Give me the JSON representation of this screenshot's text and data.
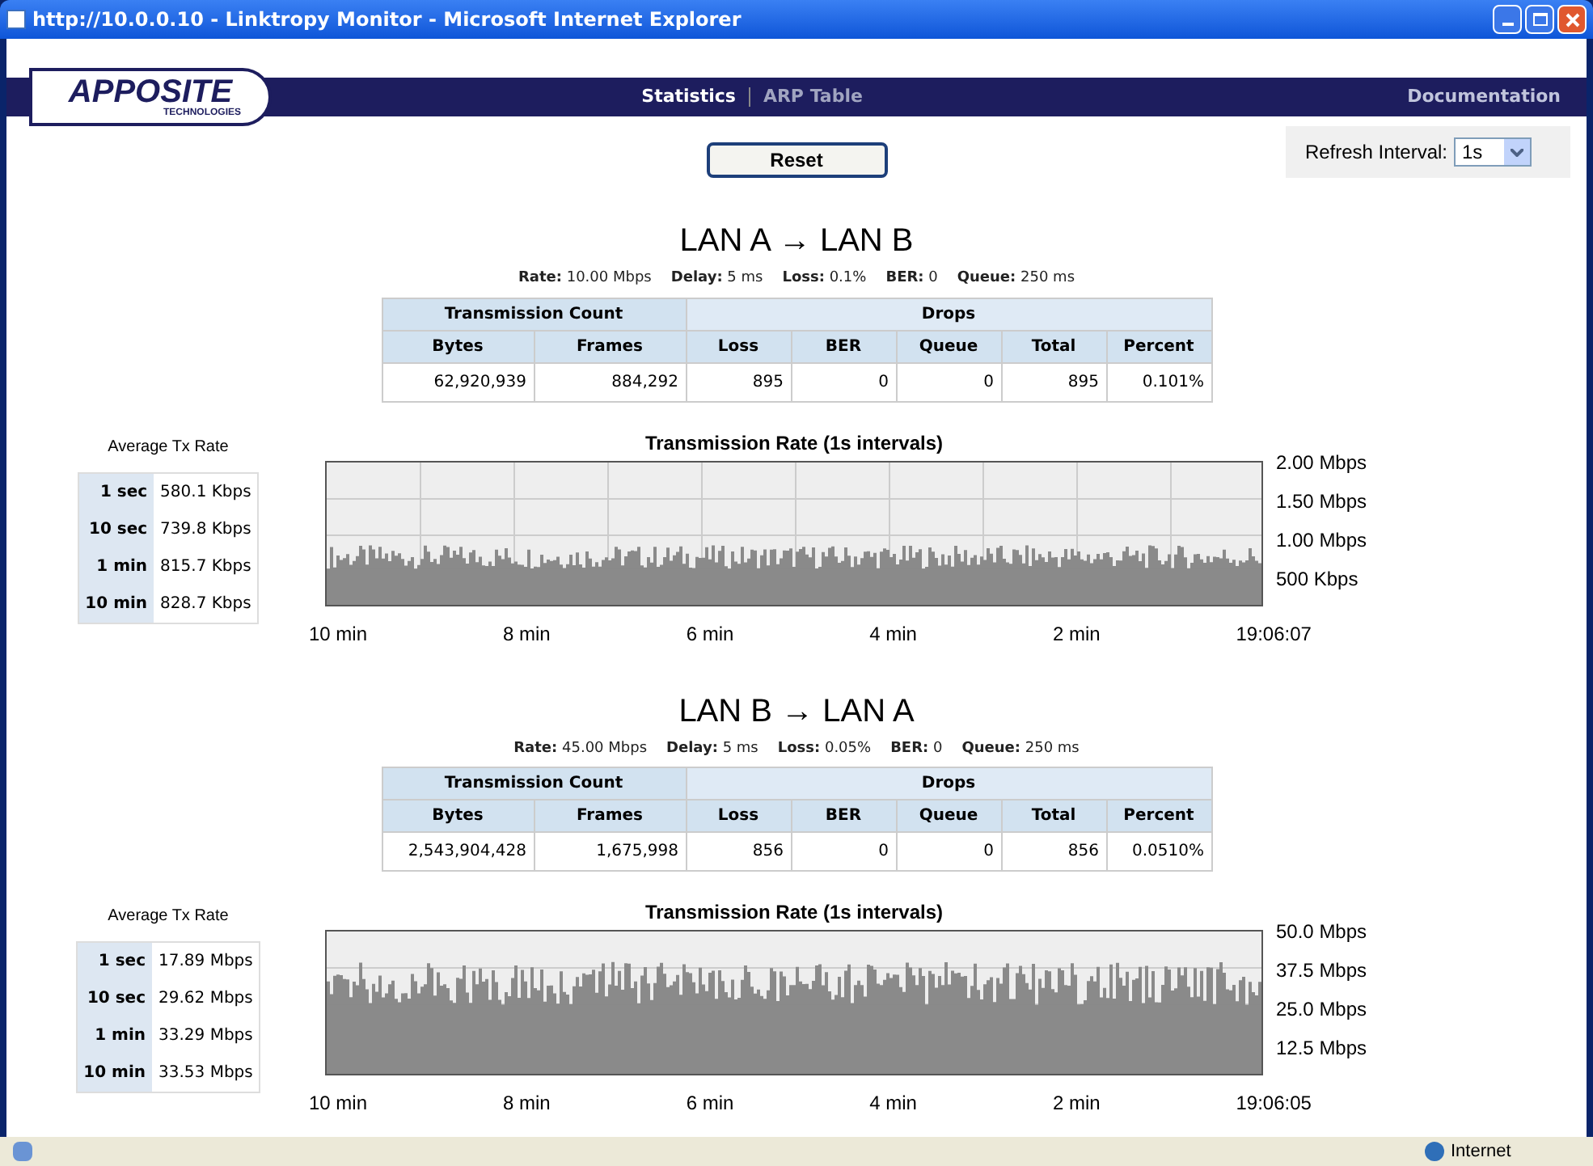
{
  "window": {
    "title": "http://10.0.0.10 - Linktropy Monitor - Microsoft Internet Explorer"
  },
  "nav": {
    "logo": "APPOSITE",
    "logo_sub": "TECHNOLOGIES",
    "items": [
      {
        "label": "Statistics",
        "selected": true
      },
      {
        "label": "ARP Table",
        "selected": false
      }
    ],
    "right_link": "Documentation"
  },
  "refresh": {
    "label": "Refresh Interval:",
    "value": "1s"
  },
  "reset_button": "Reset",
  "sections": [
    {
      "title": "LAN A → LAN B",
      "params": [
        {
          "label": "Rate:",
          "value": "10.00 Mbps"
        },
        {
          "label": "Delay:",
          "value": "5 ms"
        },
        {
          "label": "Loss:",
          "value": "0.1%"
        },
        {
          "label": "BER:",
          "value": "0"
        },
        {
          "label": "Queue:",
          "value": "250 ms"
        }
      ],
      "group_headers": [
        "Transmission Count",
        "Drops"
      ],
      "columns": [
        "Bytes",
        "Frames",
        "Loss",
        "BER",
        "Queue",
        "Total",
        "Percent"
      ],
      "row": [
        "62,920,939",
        "884,292",
        "895",
        "0",
        "0",
        "895",
        "0.101%"
      ],
      "avg_title": "Average Tx Rate",
      "avg_rows": [
        {
          "label": "1 sec",
          "value": "580.1 Kbps"
        },
        {
          "label": "10 sec",
          "value": "739.8 Kbps"
        },
        {
          "label": "1 min",
          "value": "815.7 Kbps"
        },
        {
          "label": "10 min",
          "value": "828.7 Kbps"
        }
      ],
      "chart_title": "Transmission Rate (1s intervals)",
      "y_labels": [
        "2.00 Mbps",
        "1.50 Mbps",
        "1.00 Mbps",
        "500 Kbps"
      ],
      "x_labels": [
        "10 min",
        "8 min",
        "6 min",
        "4 min",
        "2 min",
        "19:06:07"
      ]
    },
    {
      "title": "LAN B → LAN A",
      "params": [
        {
          "label": "Rate:",
          "value": "45.00 Mbps"
        },
        {
          "label": "Delay:",
          "value": "5 ms"
        },
        {
          "label": "Loss:",
          "value": "0.05%"
        },
        {
          "label": "BER:",
          "value": "0"
        },
        {
          "label": "Queue:",
          "value": "250 ms"
        }
      ],
      "group_headers": [
        "Transmission Count",
        "Drops"
      ],
      "columns": [
        "Bytes",
        "Frames",
        "Loss",
        "BER",
        "Queue",
        "Total",
        "Percent"
      ],
      "row": [
        "2,543,904,428",
        "1,675,998",
        "856",
        "0",
        "0",
        "856",
        "0.0510%"
      ],
      "avg_title": "Average Tx Rate",
      "avg_rows": [
        {
          "label": "1 sec",
          "value": "17.89 Mbps"
        },
        {
          "label": "10 sec",
          "value": "29.62 Mbps"
        },
        {
          "label": "1 min",
          "value": "33.29 Mbps"
        },
        {
          "label": "10 min",
          "value": "33.53 Mbps"
        }
      ],
      "chart_title": "Transmission Rate (1s intervals)",
      "y_labels": [
        "50.0 Mbps",
        "37.5 Mbps",
        "25.0 Mbps",
        "12.5 Mbps"
      ],
      "x_labels": [
        "10 min",
        "8 min",
        "6 min",
        "4 min",
        "2 min",
        "19:06:05"
      ]
    }
  ],
  "status_bar": {
    "zone": "Internet"
  }
}
